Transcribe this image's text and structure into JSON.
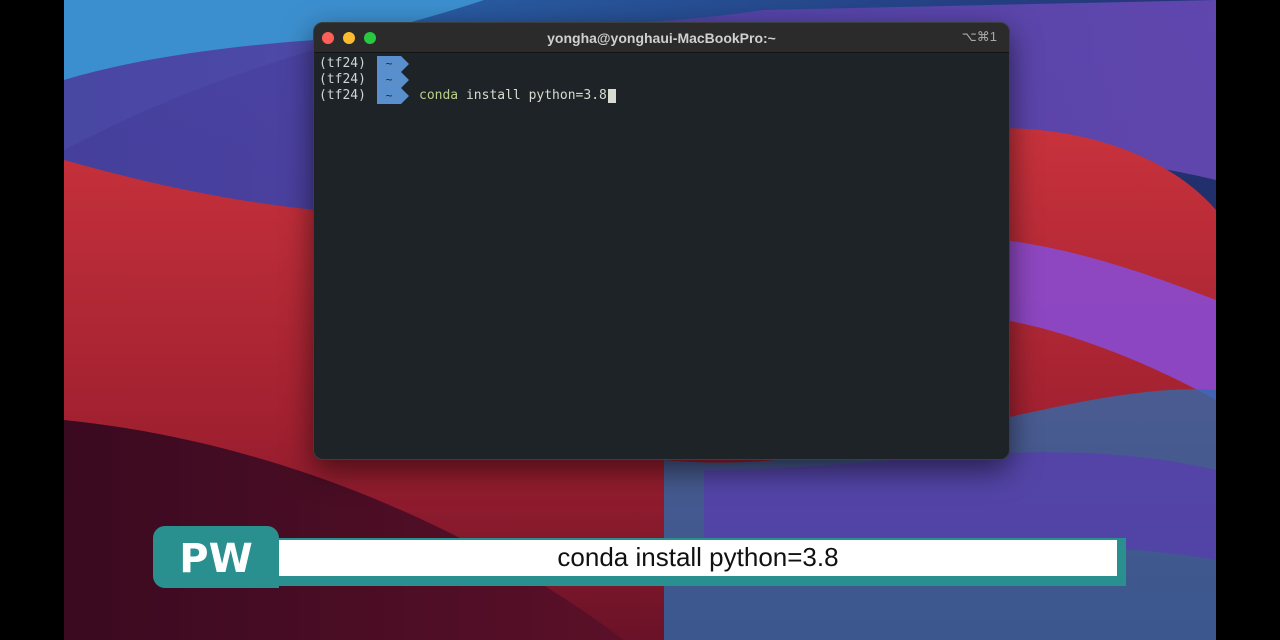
{
  "terminal": {
    "title": "yongha@yonghaui-MacBookPro:~",
    "shortcut": "⌥⌘1",
    "lines": [
      {
        "env": "(tf24)",
        "dir": "~",
        "command_first": "",
        "command_rest": ""
      },
      {
        "env": "(tf24)",
        "dir": "~",
        "command_first": "",
        "command_rest": ""
      },
      {
        "env": "(tf24)",
        "dir": "~",
        "command_first": "conda",
        "command_rest": " install python=3.8"
      }
    ]
  },
  "caption": {
    "logo": "PW",
    "text": "conda install python=3.8"
  },
  "colors": {
    "terminal_bg": "#1d2326",
    "prompt_segment": "#5a8fce",
    "caption_accent": "#2a8f8f"
  }
}
